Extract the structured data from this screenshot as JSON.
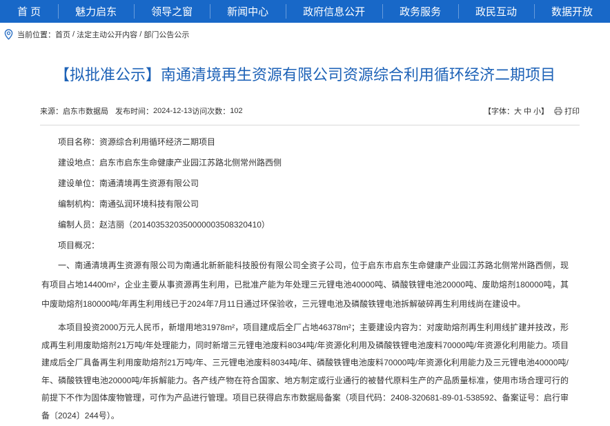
{
  "colors": {
    "nav_bg": "#1868c8",
    "nav_text": "#ffffff",
    "title": "#1d62b7",
    "text": "#333333",
    "rule": "#d9d9d9",
    "icon": "#2a6fc4"
  },
  "nav": {
    "items": [
      {
        "label": "首 页"
      },
      {
        "label": "魅力启东"
      },
      {
        "label": "领导之窗"
      },
      {
        "label": "新闻中心"
      },
      {
        "label": "政府信息公开"
      },
      {
        "label": "政务服务"
      },
      {
        "label": "政民互动"
      },
      {
        "label": "数据开放"
      }
    ]
  },
  "breadcrumb": {
    "icon": "location-pin-icon",
    "label": "当前位置：",
    "separator": " / ",
    "items": [
      "首页",
      "法定主动公开内容",
      "部门公告公示"
    ]
  },
  "article": {
    "title": "【拟批准公示】南通清境再生资源有限公司资源综合利用循环经济二期项目",
    "meta": {
      "source_label": "来源：",
      "source": "启东市数据局",
      "publish_label": "发布时间：",
      "publish_date": "2024-12-13",
      "visits_label": "访问次数：",
      "visits": "102"
    },
    "font_size": {
      "prefix": "【字体：",
      "options": [
        "大",
        "中",
        "小"
      ],
      "suffix": "】"
    },
    "print": {
      "icon": "print-icon",
      "label": "打印"
    },
    "fields": [
      {
        "label": "项目名称：",
        "value": "资源综合利用循环经济二期项目"
      },
      {
        "label": "建设地点：",
        "value": "启东市启东生命健康产业园江苏路北侧常州路西侧"
      },
      {
        "label": "建设单位：",
        "value": "南通清境再生资源有限公司"
      },
      {
        "label": "编制机构：",
        "value": "南通弘润环境科技有限公司"
      },
      {
        "label": "编制人员：",
        "value": "赵洁丽（2014035320350000003508320410）"
      }
    ],
    "overview_label": "项目概况：",
    "paragraphs": [
      "一、南通清境再生资源有限公司为南通北新新能科技股份有限公司全资子公司，位于启东市启东生命健康产业园江苏路北侧常州路西侧，现有项目占地14400m²，企业主要从事资源再生利用，已批准产能为年处理三元锂电池40000吨、磷酸铁锂电池20000吨、废助熔剂180000吨，其中废助熔剂180000吨/年再生利用线已于2024年7月11日通过环保验收，三元锂电池及磷酸铁锂电池拆解破碎再生利用线尚在建设中。",
      "本项目投资2000万元人民币，新增用地31978m²，项目建成后全厂占地46378m²；主要建设内容为：对废助熔剂再生利用线扩建并技改，形成再生利用废助熔剂21万吨/年处理能力，同时新增三元锂电池废料8034吨/年资源化利用及磷酸铁锂电池废料70000吨/年资源化利用能力。项目建成后全厂具备再生利用废助熔剂21万吨/年、三元锂电池废料8034吨/年、磷酸铁锂电池废料70000吨/年资源化利用能力及三元锂电池40000吨/年、磷酸铁锂电池20000吨/年拆解能力。各产线产物在符合国家、地方制定或行业通行的被替代原料生产的产品质量标准，使用市场合理可行的前提下不作为固体废物管理，可作为产品进行管理。项目已获得启东市数据局备案（项目代码：2408-320681-89-01-538592、备案证号：启行审备〔2024〕244号）。"
    ]
  }
}
